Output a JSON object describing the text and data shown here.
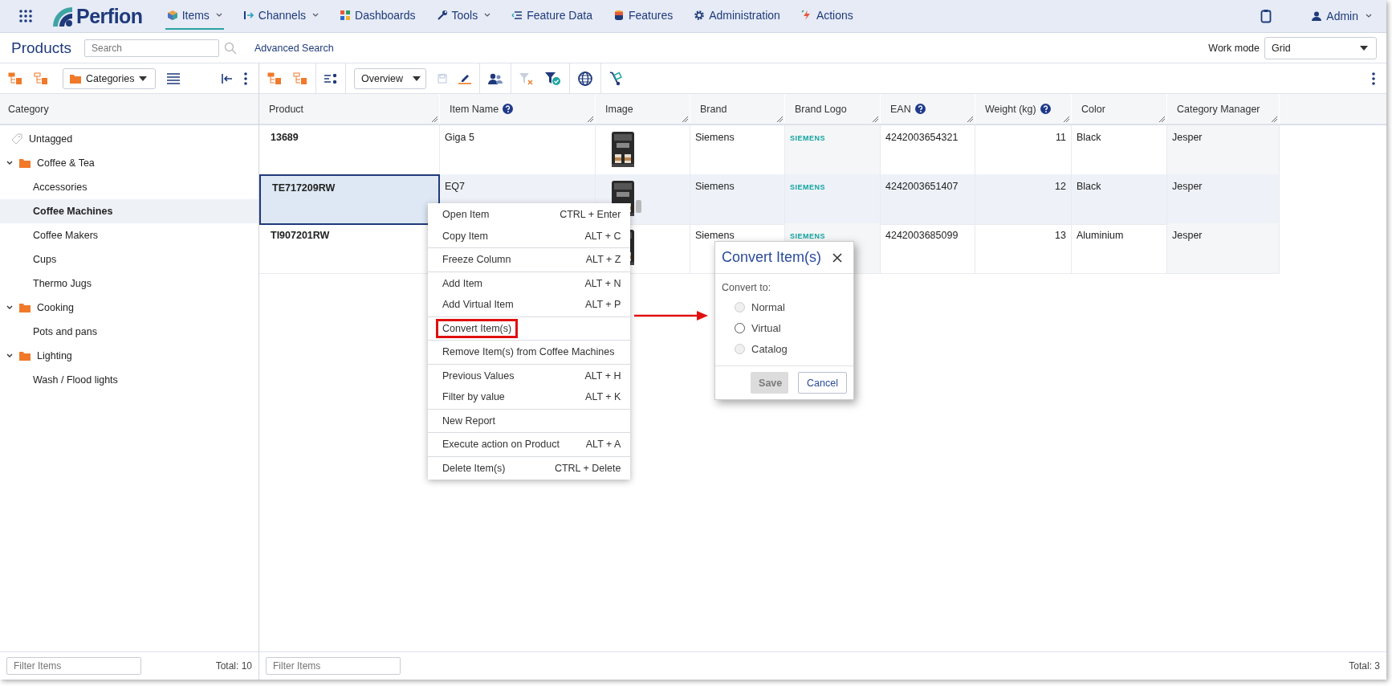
{
  "app": {
    "logo": "Perfion"
  },
  "nav": [
    {
      "label": "Items",
      "kind": "box",
      "dropdown": true,
      "selected": true
    },
    {
      "label": "Channels",
      "kind": "channel",
      "dropdown": true,
      "selected": false
    },
    {
      "label": "Dashboards",
      "kind": "dash",
      "dropdown": false,
      "selected": false
    },
    {
      "label": "Tools",
      "kind": "wrench",
      "dropdown": true,
      "selected": false
    },
    {
      "label": "Feature Data",
      "kind": "list",
      "dropdown": false,
      "selected": false
    },
    {
      "label": "Features",
      "kind": "db",
      "dropdown": false,
      "selected": false
    },
    {
      "label": "Administration",
      "kind": "gear",
      "dropdown": false,
      "selected": false
    },
    {
      "label": "Actions",
      "kind": "bolt",
      "dropdown": false,
      "selected": false
    }
  ],
  "user": {
    "label": "Admin"
  },
  "page": {
    "title": "Products",
    "search_placeholder": "Search",
    "advanced_search": "Advanced Search",
    "work_mode_label": "Work mode",
    "work_mode": "Grid"
  },
  "left_toolbar": {
    "view": "Categories"
  },
  "grid_toolbar": {
    "view": "Overview"
  },
  "category_panel": {
    "header": "Category",
    "items": [
      {
        "label": "Untagged",
        "kind": "tag",
        "selected": false
      },
      {
        "label": "Coffee & Tea",
        "kind": "folder",
        "expanded": true,
        "selected": false,
        "children": [
          {
            "label": "Accessories",
            "selected": false
          },
          {
            "label": "Coffee Machines",
            "selected": true
          },
          {
            "label": "Coffee Makers",
            "selected": false
          },
          {
            "label": "Cups",
            "selected": false
          },
          {
            "label": "Thermo Jugs",
            "selected": false
          }
        ]
      },
      {
        "label": "Cooking",
        "kind": "folder",
        "expanded": true,
        "selected": false,
        "children": [
          {
            "label": "Pots and pans",
            "selected": false
          }
        ]
      },
      {
        "label": "Lighting",
        "kind": "folder",
        "expanded": true,
        "selected": false,
        "children": [
          {
            "label": "Wash / Flood lights",
            "selected": false
          }
        ]
      }
    ],
    "filter_placeholder": "Filter Items",
    "total": "Total: 10"
  },
  "table": {
    "columns": [
      {
        "label": "Product",
        "help": false
      },
      {
        "label": "Item Name",
        "help": true
      },
      {
        "label": "Image",
        "help": false
      },
      {
        "label": "Brand",
        "help": false
      },
      {
        "label": "Brand Logo",
        "help": false
      },
      {
        "label": "EAN",
        "help": true
      },
      {
        "label": "Weight (kg)",
        "help": true
      },
      {
        "label": "Color",
        "help": false
      },
      {
        "label": "Category Manager",
        "help": false
      }
    ],
    "rows": [
      {
        "product": "13689",
        "item_name": "Giga 5",
        "brand": "Siemens",
        "brand_logo": "SIEMENS",
        "ean": "4242003654321",
        "weight": "11",
        "item_color": "Black",
        "category_manager": "Jesper",
        "selected": false
      },
      {
        "product": "TE717209RW",
        "item_name": "EQ7",
        "brand": "Siemens",
        "brand_logo": "SIEMENS",
        "ean": "4242003651407",
        "weight": "12",
        "item_color": "Black",
        "category_manager": "Jesper",
        "selected": true
      },
      {
        "product": "TI907201RW",
        "brand": "Siemens",
        "brand_logo": "SIEMENS",
        "ean": "4242003685099",
        "weight": "13",
        "item_color": "Aluminium",
        "category_manager": "Jesper",
        "selected": false
      }
    ],
    "filter_placeholder": "Filter Items",
    "total": "Total: 3"
  },
  "context_menu": {
    "groups": [
      [
        {
          "label": "Open Item",
          "shortcut": "CTRL + Enter",
          "highlighted": false
        },
        {
          "label": "Copy Item",
          "shortcut": "ALT + C",
          "highlighted": false
        }
      ],
      [
        {
          "label": "Freeze Column",
          "shortcut": "ALT + Z",
          "highlighted": false
        }
      ],
      [
        {
          "label": "Add Item",
          "shortcut": "ALT + N",
          "highlighted": false
        },
        {
          "label": "Add Virtual Item",
          "shortcut": "ALT + P",
          "highlighted": false
        }
      ],
      [
        {
          "label": "Convert Item(s)",
          "highlighted": true
        }
      ],
      [
        {
          "label": "Remove Item(s) from Coffee Machines",
          "highlighted": false
        }
      ],
      [
        {
          "label": "Previous Values",
          "shortcut": "ALT + H",
          "highlighted": false
        },
        {
          "label": "Filter by value",
          "shortcut": "ALT + K",
          "highlighted": false
        }
      ],
      [
        {
          "label": "New Report",
          "highlighted": false
        }
      ],
      [
        {
          "label": "Execute action on Product",
          "shortcut": "ALT + A",
          "highlighted": false
        }
      ],
      [
        {
          "label": "Delete Item(s)",
          "shortcut": "CTRL + Delete",
          "highlighted": false
        }
      ]
    ]
  },
  "dialog": {
    "title": "Convert Item(s)",
    "prompt": "Convert to:",
    "options": [
      {
        "label": "Normal",
        "selected": false,
        "disabled": true
      },
      {
        "label": "Virtual",
        "selected": false,
        "disabled": false
      },
      {
        "label": "Catalog",
        "selected": false,
        "disabled": true
      }
    ],
    "buttons": [
      {
        "label": "Save",
        "kind": "primary",
        "disabled": true
      },
      {
        "label": "Cancel",
        "kind": "secondary",
        "disabled": false
      }
    ]
  }
}
